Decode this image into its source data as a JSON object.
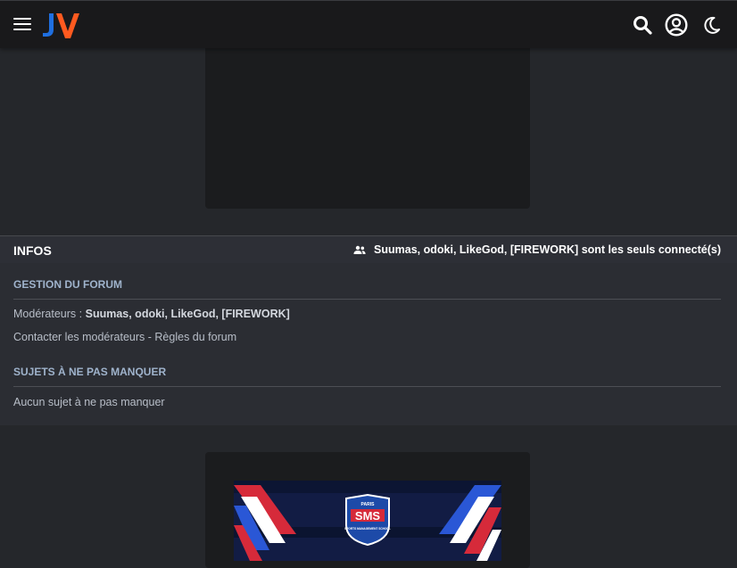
{
  "header": {
    "icons": [
      "menu-icon",
      "jv-logo",
      "search-icon",
      "account-icon",
      "moon-icon"
    ]
  },
  "infos": {
    "title": "INFOS",
    "connected_text": "Suumas, odoki, LikeGod, [FIREWORK] sont les seuls connecté(s)"
  },
  "gestion": {
    "heading": "GESTION DU FORUM",
    "moderators_label": "Modérateurs :",
    "moderators": "Suumas, odoki, LikeGod, [FIREWORK]",
    "contact_link": "Contacter les modérateurs",
    "separator": " - ",
    "rules_link": "Règles du forum"
  },
  "sujets": {
    "heading": "SUJETS À NE PAS MANQUER",
    "empty_text": "Aucun sujet à ne pas manquer"
  },
  "banner": {
    "badge_top": "PARIS",
    "badge_main": "SMS",
    "badge_sub": "SPORTS MANAGEMENT SCHOOL"
  },
  "colors": {
    "logo_blue": "#1f6fe0",
    "logo_orange": "#ff5a1f",
    "header_bg": "#19191b",
    "page_bg": "#25272b",
    "section_heading": "#9fb3cc"
  }
}
